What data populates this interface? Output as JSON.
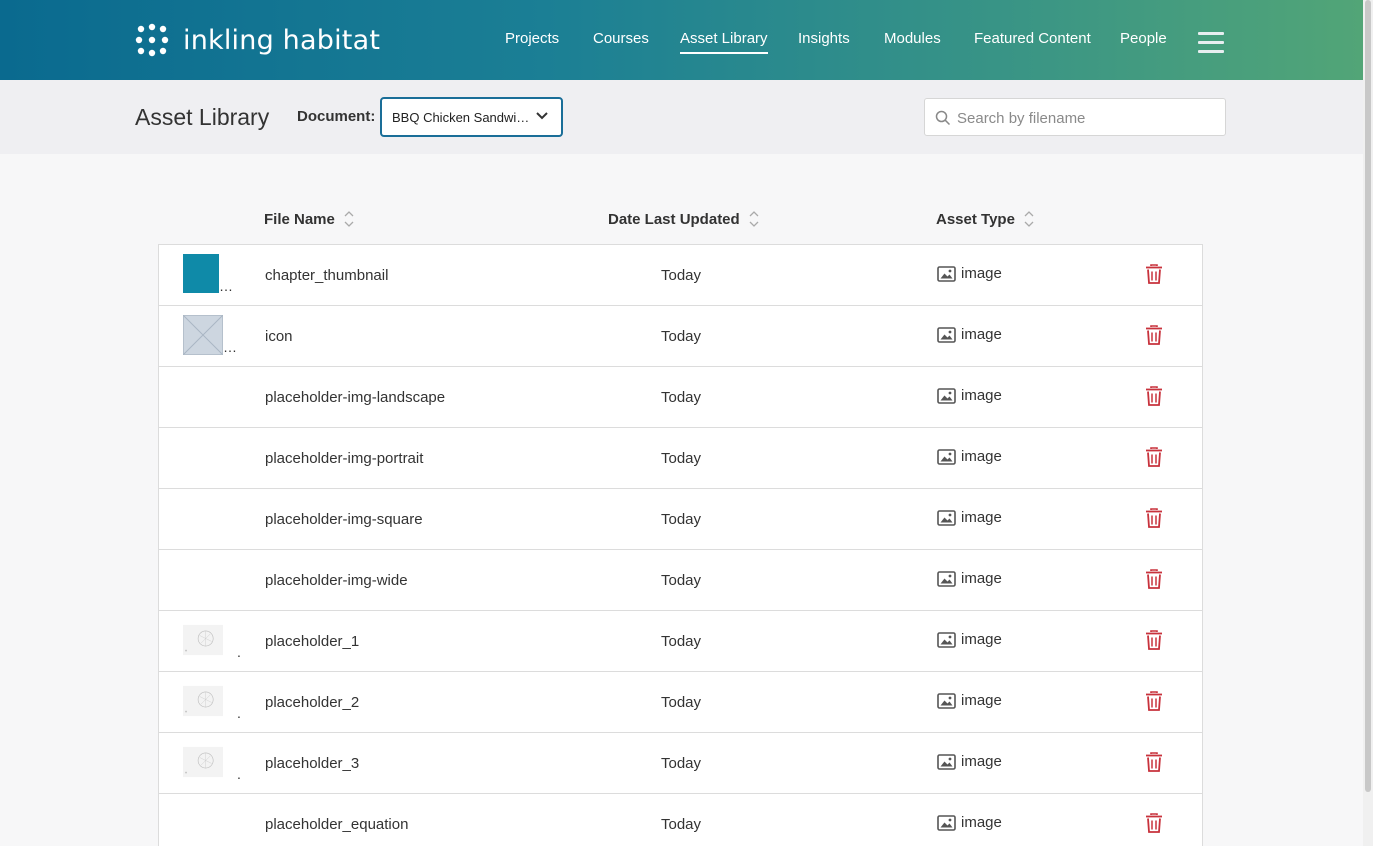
{
  "app": {
    "logo_text": "inkling habitat"
  },
  "nav": {
    "items": [
      {
        "label": "Projects"
      },
      {
        "label": "Courses"
      },
      {
        "label": "Asset Library",
        "active": true
      },
      {
        "label": "Insights"
      },
      {
        "label": "Modules"
      },
      {
        "label": "Featured Content"
      },
      {
        "label": "People"
      }
    ]
  },
  "subheader": {
    "title": "Asset Library",
    "document_label": "Document:",
    "document_value": "BBQ Chicken Sandwi…",
    "search_placeholder": "Search by filename"
  },
  "table": {
    "columns": {
      "file_name": "File Name",
      "date": "Date Last Updated",
      "type": "Asset Type"
    },
    "rows": [
      {
        "name": "chapter_thumbnail",
        "date": "Today",
        "type": "image",
        "thumb": "chapter"
      },
      {
        "name": "icon",
        "date": "Today",
        "type": "image",
        "thumb": "placeholder-x"
      },
      {
        "name": "placeholder-img-landscape",
        "date": "Today",
        "type": "image",
        "thumb": "none"
      },
      {
        "name": "placeholder-img-portrait",
        "date": "Today",
        "type": "image",
        "thumb": "none"
      },
      {
        "name": "placeholder-img-square",
        "date": "Today",
        "type": "image",
        "thumb": "none"
      },
      {
        "name": "placeholder-img-wide",
        "date": "Today",
        "type": "image",
        "thumb": "none"
      },
      {
        "name": "placeholder_1",
        "date": "Today",
        "type": "image",
        "thumb": "sketch"
      },
      {
        "name": "placeholder_2",
        "date": "Today",
        "type": "image",
        "thumb": "sketch"
      },
      {
        "name": "placeholder_3",
        "date": "Today",
        "type": "image",
        "thumb": "sketch"
      },
      {
        "name": "placeholder_equation",
        "date": "Today",
        "type": "image",
        "thumb": "none"
      }
    ]
  },
  "colors": {
    "delete": "#c8323c",
    "header_gradient_start": "#0a6a8f",
    "header_gradient_end": "#52a577",
    "select_border": "#1a6e98"
  }
}
